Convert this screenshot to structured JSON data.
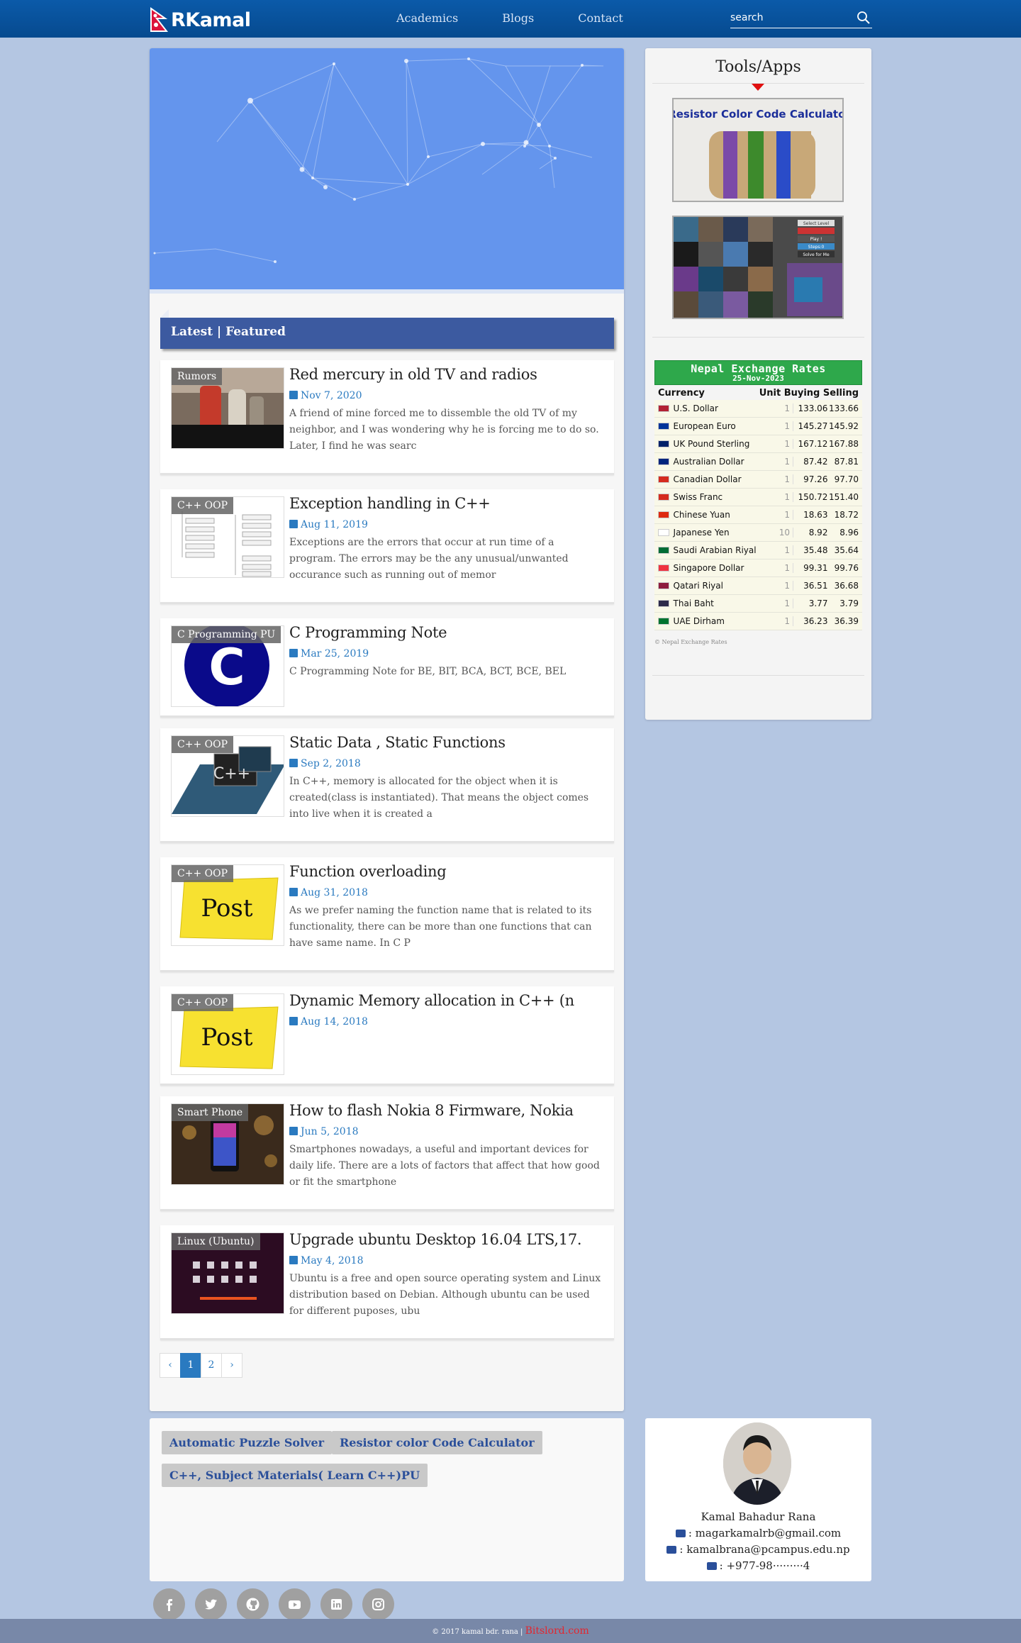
{
  "header": {
    "logo_text": "RKamal",
    "nav": [
      "Academics",
      "Blogs",
      "Contact"
    ],
    "search_placeholder": "search"
  },
  "main": {
    "featured_label": "Latest | Featured",
    "posts": [
      {
        "tag": "Rumors",
        "title": "Red mercury in old TV and radios",
        "date": "Nov 7, 2020",
        "excerpt": "A friend of mine forced me to dissemble the old TV of my neighbor, and I was wondering why he is forcing me to do so. Later, I find he was searc"
      },
      {
        "tag": "C++ OOP",
        "title": "Exception handling in C++",
        "date": "Aug 11, 2019",
        "excerpt": "Exceptions are the errors that occur at run time of a program. The errors may be the any unusual/unwanted occurance such as running out of memor"
      },
      {
        "tag": "C Programming PU",
        "title": "C Programming Note",
        "date": "Mar 25, 2019",
        "excerpt": "C Programming Note for BE, BIT, BCA, BCT, BCE, BEL"
      },
      {
        "tag": "C++ OOP",
        "title": "Static Data , Static Functions",
        "date": "Sep 2, 2018",
        "excerpt": "In C++, memory is allocated for the object when it is created(class is instantiated). That means the object comes into live when it is created a"
      },
      {
        "tag": "C++ OOP",
        "title": "Function overloading",
        "date": "Aug 31, 2018",
        "excerpt": "As we prefer naming the function name that is related to its functionality, there can be more than one functions that can have same name. In C P"
      },
      {
        "tag": "C++ OOP",
        "title": "Dynamic Memory allocation in C++ (n",
        "date": "Aug 14, 2018",
        "excerpt": ""
      },
      {
        "tag": "Smart Phone",
        "title": "How to flash Nokia 8 Firmware, Nokia",
        "date": "Jun 5, 2018",
        "excerpt": "Smartphones nowadays, a useful and important devices for daily life. There are a lots of factors that affect that how good or fit the smartphone"
      },
      {
        "tag": "Linux (Ubuntu)",
        "title": "Upgrade ubuntu Desktop 16.04 LTS,17.",
        "date": "May 4, 2018",
        "excerpt": "Ubuntu is a free and open source operating system and Linux distribution based on Debian. Although ubuntu can be used for different puposes, ubu"
      }
    ],
    "pager": {
      "prev": "‹",
      "pages": [
        "1",
        "2"
      ],
      "next": "›",
      "current": "1"
    }
  },
  "sidebar": {
    "title": "Tools/Apps",
    "app1_label": "Resistor Color Code Calculator",
    "app2_buttons": [
      "Select Level",
      "Play !",
      "Steps:0",
      "Solve for Me"
    ],
    "fx": {
      "title": "Nepal Exchange Rates",
      "date": "25-Nov-2023",
      "col_currency": "Currency",
      "col_rates": "Unit Buying Selling",
      "rows": [
        {
          "name": "U.S. Dollar",
          "unit": "1",
          "buy": "133.06",
          "sell": "133.66",
          "flag": "#b22234"
        },
        {
          "name": "European Euro",
          "unit": "1",
          "buy": "145.27",
          "sell": "145.92",
          "flag": "#003399"
        },
        {
          "name": "UK Pound Sterling",
          "unit": "1",
          "buy": "167.12",
          "sell": "167.88",
          "flag": "#012169"
        },
        {
          "name": "Australian Dollar",
          "unit": "1",
          "buy": "87.42",
          "sell": "87.81",
          "flag": "#00247d"
        },
        {
          "name": "Canadian Dollar",
          "unit": "1",
          "buy": "97.26",
          "sell": "97.70",
          "flag": "#d52b1e"
        },
        {
          "name": "Swiss Franc",
          "unit": "1",
          "buy": "150.72",
          "sell": "151.40",
          "flag": "#d52b1e"
        },
        {
          "name": "Chinese Yuan",
          "unit": "1",
          "buy": "18.63",
          "sell": "18.72",
          "flag": "#de2910"
        },
        {
          "name": "Japanese Yen",
          "unit": "10",
          "buy": "8.92",
          "sell": "8.96",
          "flag": "#ffffff"
        },
        {
          "name": "Saudi Arabian Riyal",
          "unit": "1",
          "buy": "35.48",
          "sell": "35.64",
          "flag": "#006c35"
        },
        {
          "name": "Singapore Dollar",
          "unit": "1",
          "buy": "99.31",
          "sell": "99.76",
          "flag": "#ef3340"
        },
        {
          "name": "Qatari Riyal",
          "unit": "1",
          "buy": "36.51",
          "sell": "36.68",
          "flag": "#8d1b3d"
        },
        {
          "name": "Thai Baht",
          "unit": "1",
          "buy": "3.77",
          "sell": "3.79",
          "flag": "#2d2a4a"
        },
        {
          "name": "UAE Dirham",
          "unit": "1",
          "buy": "36.23",
          "sell": "36.39",
          "flag": "#00732f"
        }
      ],
      "footer": "© Nepal Exchange Rates"
    }
  },
  "links": [
    "Automatic Puzzle Solver",
    "Resistor color Code Calculator",
    "C++, Subject Materials( Learn C++)PU"
  ],
  "profile": {
    "name": "Kamal Bahadur Rana",
    "email1": ": magarkamalrb@gmail.com",
    "email2": ": kamalbrana@pcampus.edu.np",
    "phone": ": +977-98·········4"
  },
  "social": [
    "facebook-icon",
    "twitter-icon",
    "github-icon",
    "youtube-icon",
    "linkedin-icon",
    "instagram-icon"
  ],
  "footer": {
    "copyright": "© 2017 kamal bdr. rana |",
    "brand": "Bitslord.com"
  }
}
